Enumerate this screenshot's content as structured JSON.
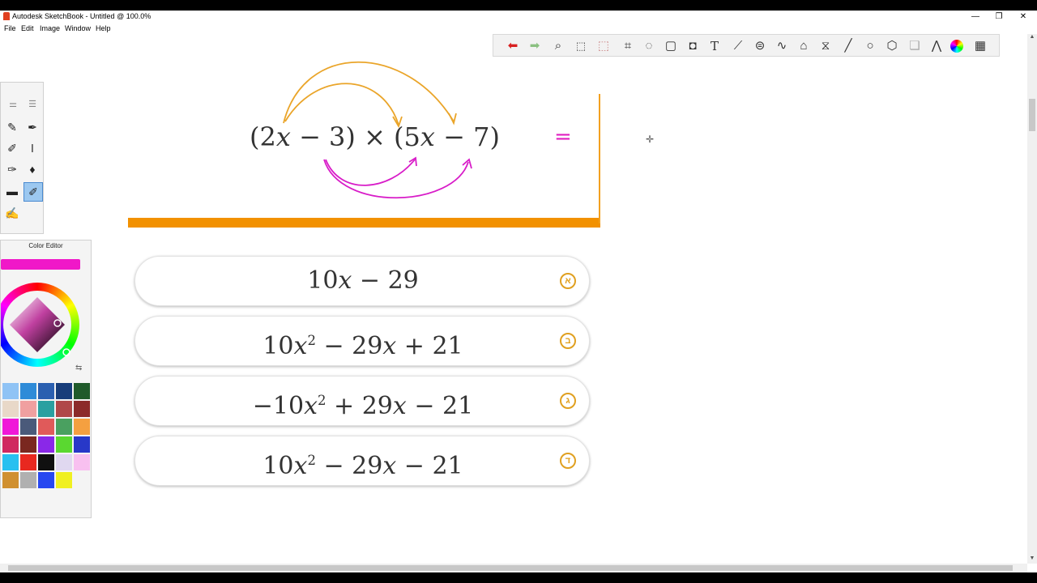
{
  "window": {
    "title": "Autodesk SketchBook - Untitled @ 100.0%"
  },
  "menu": [
    "File",
    "Edit",
    "Image",
    "Window",
    "Help"
  ],
  "color_editor": {
    "title": "Color Editor",
    "current_color": "#f018c8"
  },
  "swatches": [
    "#8fc3f5",
    "#2e8bd8",
    "#2a5fb0",
    "#173d7a",
    "#1f5a2a",
    "#e8d8c8",
    "#f0a0a0",
    "#2aa0a0",
    "#b04848",
    "#8c2a2a",
    "#f018d8",
    "#4a5a7a",
    "#e05a5a",
    "#4aa060",
    "#f5a040",
    "#d02860",
    "#7a2820",
    "#8a28e8",
    "#5ad830",
    "#2838c8",
    "#28c0f0",
    "#e82820",
    "#101010",
    "#e0d8f0",
    "#f8c0f0",
    "#d09030",
    "#b0b0b0",
    "#2848f0",
    "#f0f020"
  ],
  "problem": {
    "expression_html": "(2<i>x</i> − 3) × (5<i>x</i> − 7)",
    "equals": "="
  },
  "options": [
    {
      "letter": "א",
      "expression_html": "10<i>x</i> − 29"
    },
    {
      "letter": "ב",
      "expression_html": "10<i>x</i><sup>2</sup> − 29<i>x</i> + 21"
    },
    {
      "letter": "ג",
      "expression_html": "−10<i>x</i><sup>2</sup> + 29<i>x</i> − 21"
    },
    {
      "letter": "ד",
      "expression_html": "10<i>x</i><sup>2</sup> − 29<i>x</i> − 21"
    }
  ],
  "colors": {
    "orange": "#f29100",
    "magenta": "#e020c0",
    "accent": "#e0a020"
  }
}
